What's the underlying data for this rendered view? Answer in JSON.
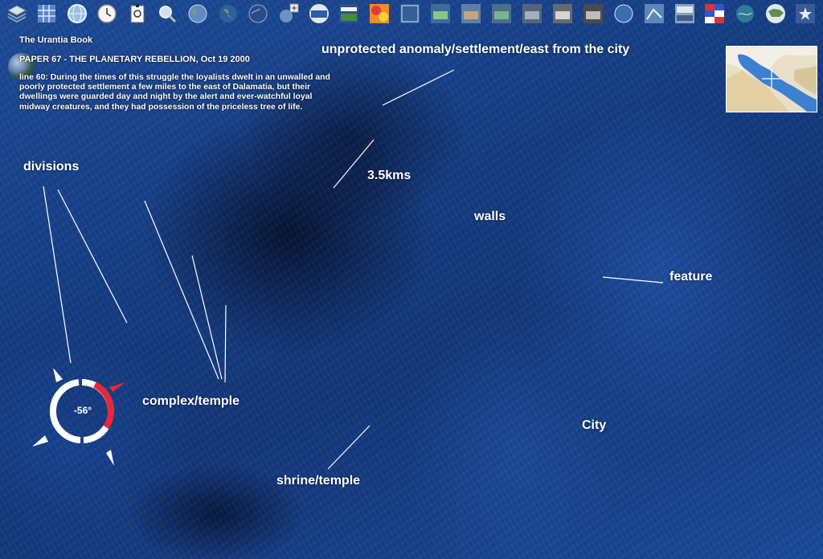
{
  "toolbar": {
    "icons": [
      "layers-icon",
      "grid-icon",
      "globe-view-icon",
      "clock-icon",
      "placemark-icon",
      "zoom-icon",
      "globe-icon",
      "earth-icon",
      "earth-night-icon",
      "add-layer-icon",
      "layer-thumb-1-icon",
      "layer-thumb-2-icon",
      "layer-thumb-3-icon",
      "layer-thumb-4-icon",
      "layer-thumb-5-icon",
      "layer-thumb-6-icon",
      "layer-thumb-7-icon",
      "layer-thumb-8-icon",
      "layer-thumb-9-icon",
      "layer-thumb-10-icon",
      "small-globe-icon",
      "layer-thumb-11-icon",
      "layer-thumb-12-icon",
      "flags-icon",
      "layer-thumb-13-icon",
      "usa-map-icon",
      "star-map-icon"
    ]
  },
  "info": {
    "book": "The Urantia Book",
    "paper": "PAPER 67 - THE PLANETARY REBELLION, Oct 19 2000",
    "quote": "line 60: During the times of this struggle the loyalists dwelt in an unwalled and poorly protected settlement a few miles to the east of Dalamatia, but their dwellings were guarded day and night by the alert and ever-watchful loyal midway creatures, and they had possession of the priceless tree of life."
  },
  "labels": {
    "unprotected": "unprotected anomaly/settlement/east from the city",
    "divisions": "divisions",
    "distance": "3.5kms",
    "walls": "walls",
    "feature": "feature",
    "complex": "complex/temple",
    "city": "City",
    "shrine": "shrine/temple"
  },
  "compass": {
    "heading": "-56°"
  },
  "colors": {
    "ocean": "#153e86",
    "accent_red": "#e8283a",
    "text": "#ffffff"
  }
}
